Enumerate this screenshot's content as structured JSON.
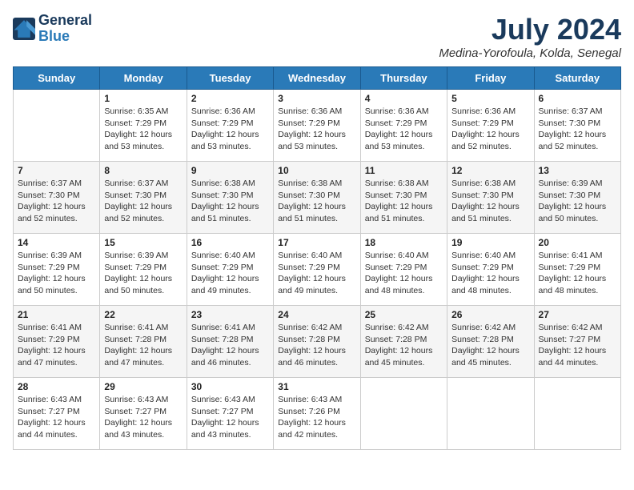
{
  "header": {
    "logo_line1": "General",
    "logo_line2": "Blue",
    "month_title": "July 2024",
    "location": "Medina-Yorofoula, Kolda, Senegal"
  },
  "days_of_week": [
    "Sunday",
    "Monday",
    "Tuesday",
    "Wednesday",
    "Thursday",
    "Friday",
    "Saturday"
  ],
  "weeks": [
    [
      {
        "day": "",
        "info": ""
      },
      {
        "day": "1",
        "info": "Sunrise: 6:35 AM\nSunset: 7:29 PM\nDaylight: 12 hours and 53 minutes."
      },
      {
        "day": "2",
        "info": "Sunrise: 6:36 AM\nSunset: 7:29 PM\nDaylight: 12 hours and 53 minutes."
      },
      {
        "day": "3",
        "info": "Sunrise: 6:36 AM\nSunset: 7:29 PM\nDaylight: 12 hours and 53 minutes."
      },
      {
        "day": "4",
        "info": "Sunrise: 6:36 AM\nSunset: 7:29 PM\nDaylight: 12 hours and 53 minutes."
      },
      {
        "day": "5",
        "info": "Sunrise: 6:36 AM\nSunset: 7:29 PM\nDaylight: 12 hours and 52 minutes."
      },
      {
        "day": "6",
        "info": "Sunrise: 6:37 AM\nSunset: 7:30 PM\nDaylight: 12 hours and 52 minutes."
      }
    ],
    [
      {
        "day": "7",
        "info": "Sunrise: 6:37 AM\nSunset: 7:30 PM\nDaylight: 12 hours and 52 minutes."
      },
      {
        "day": "8",
        "info": "Sunrise: 6:37 AM\nSunset: 7:30 PM\nDaylight: 12 hours and 52 minutes."
      },
      {
        "day": "9",
        "info": "Sunrise: 6:38 AM\nSunset: 7:30 PM\nDaylight: 12 hours and 51 minutes."
      },
      {
        "day": "10",
        "info": "Sunrise: 6:38 AM\nSunset: 7:30 PM\nDaylight: 12 hours and 51 minutes."
      },
      {
        "day": "11",
        "info": "Sunrise: 6:38 AM\nSunset: 7:30 PM\nDaylight: 12 hours and 51 minutes."
      },
      {
        "day": "12",
        "info": "Sunrise: 6:38 AM\nSunset: 7:30 PM\nDaylight: 12 hours and 51 minutes."
      },
      {
        "day": "13",
        "info": "Sunrise: 6:39 AM\nSunset: 7:30 PM\nDaylight: 12 hours and 50 minutes."
      }
    ],
    [
      {
        "day": "14",
        "info": "Sunrise: 6:39 AM\nSunset: 7:29 PM\nDaylight: 12 hours and 50 minutes."
      },
      {
        "day": "15",
        "info": "Sunrise: 6:39 AM\nSunset: 7:29 PM\nDaylight: 12 hours and 50 minutes."
      },
      {
        "day": "16",
        "info": "Sunrise: 6:40 AM\nSunset: 7:29 PM\nDaylight: 12 hours and 49 minutes."
      },
      {
        "day": "17",
        "info": "Sunrise: 6:40 AM\nSunset: 7:29 PM\nDaylight: 12 hours and 49 minutes."
      },
      {
        "day": "18",
        "info": "Sunrise: 6:40 AM\nSunset: 7:29 PM\nDaylight: 12 hours and 48 minutes."
      },
      {
        "day": "19",
        "info": "Sunrise: 6:40 AM\nSunset: 7:29 PM\nDaylight: 12 hours and 48 minutes."
      },
      {
        "day": "20",
        "info": "Sunrise: 6:41 AM\nSunset: 7:29 PM\nDaylight: 12 hours and 48 minutes."
      }
    ],
    [
      {
        "day": "21",
        "info": "Sunrise: 6:41 AM\nSunset: 7:29 PM\nDaylight: 12 hours and 47 minutes."
      },
      {
        "day": "22",
        "info": "Sunrise: 6:41 AM\nSunset: 7:28 PM\nDaylight: 12 hours and 47 minutes."
      },
      {
        "day": "23",
        "info": "Sunrise: 6:41 AM\nSunset: 7:28 PM\nDaylight: 12 hours and 46 minutes."
      },
      {
        "day": "24",
        "info": "Sunrise: 6:42 AM\nSunset: 7:28 PM\nDaylight: 12 hours and 46 minutes."
      },
      {
        "day": "25",
        "info": "Sunrise: 6:42 AM\nSunset: 7:28 PM\nDaylight: 12 hours and 45 minutes."
      },
      {
        "day": "26",
        "info": "Sunrise: 6:42 AM\nSunset: 7:28 PM\nDaylight: 12 hours and 45 minutes."
      },
      {
        "day": "27",
        "info": "Sunrise: 6:42 AM\nSunset: 7:27 PM\nDaylight: 12 hours and 44 minutes."
      }
    ],
    [
      {
        "day": "28",
        "info": "Sunrise: 6:43 AM\nSunset: 7:27 PM\nDaylight: 12 hours and 44 minutes."
      },
      {
        "day": "29",
        "info": "Sunrise: 6:43 AM\nSunset: 7:27 PM\nDaylight: 12 hours and 43 minutes."
      },
      {
        "day": "30",
        "info": "Sunrise: 6:43 AM\nSunset: 7:27 PM\nDaylight: 12 hours and 43 minutes."
      },
      {
        "day": "31",
        "info": "Sunrise: 6:43 AM\nSunset: 7:26 PM\nDaylight: 12 hours and 42 minutes."
      },
      {
        "day": "",
        "info": ""
      },
      {
        "day": "",
        "info": ""
      },
      {
        "day": "",
        "info": ""
      }
    ]
  ]
}
